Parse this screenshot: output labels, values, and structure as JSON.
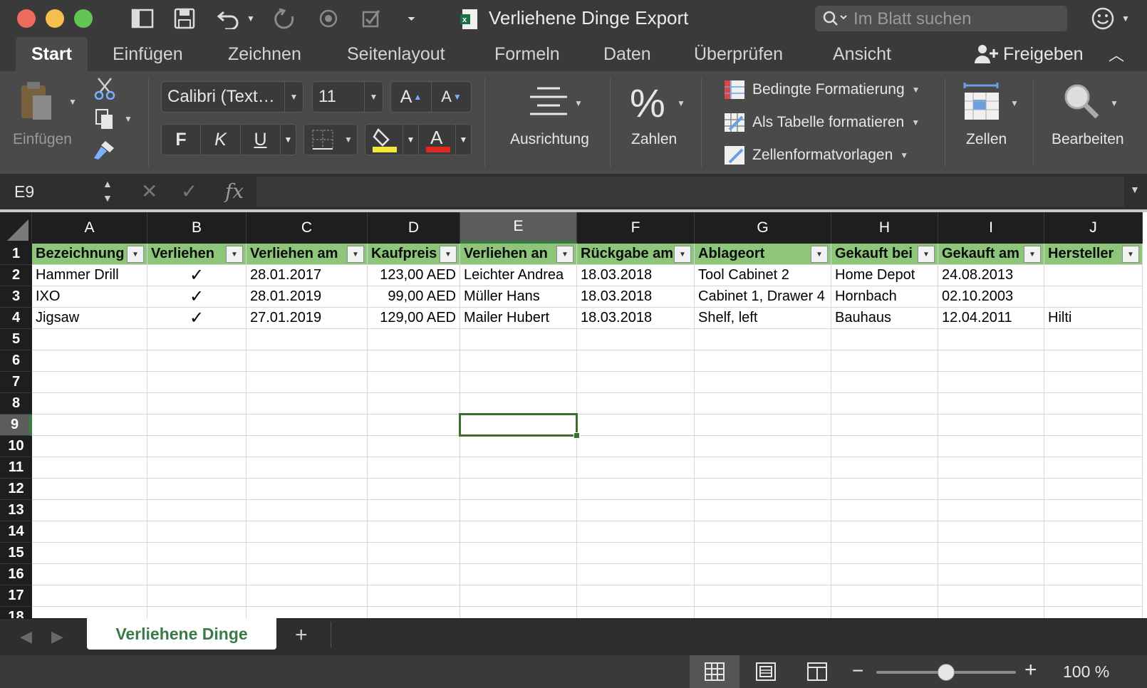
{
  "window": {
    "title": "Verliehene Dinge Export",
    "search_placeholder": "Im Blatt suchen"
  },
  "ribbon_tabs": [
    "Start",
    "Einfügen",
    "Zeichnen",
    "Seitenlayout",
    "Formeln",
    "Daten",
    "Überprüfen",
    "Ansicht"
  ],
  "share_label": "Freigeben",
  "ribbon": {
    "paste_label": "Einfügen",
    "font_name": "Calibri (Text…",
    "font_size": "11",
    "grow_font": "A",
    "shrink_font": "A",
    "bold": "F",
    "italic": "K",
    "underline": "U",
    "alignment_label": "Ausrichtung",
    "numbers_symbol": "%",
    "numbers_label": "Zahlen",
    "conditional_formatting": "Bedingte Formatierung",
    "format_as_table": "Als Tabelle formatieren",
    "cell_styles": "Zellenformatvorlagen",
    "cells_label": "Zellen",
    "edit_label": "Bearbeiten"
  },
  "formula_bar": {
    "name_box": "E9",
    "fx": "fx",
    "content": ""
  },
  "grid": {
    "columns": [
      "A",
      "B",
      "C",
      "D",
      "E",
      "F",
      "G",
      "H",
      "I",
      "J"
    ],
    "rows": [
      "1",
      "2",
      "3",
      "4",
      "5",
      "6",
      "7",
      "8",
      "9",
      "10",
      "11",
      "12",
      "13",
      "14",
      "15",
      "16",
      "17"
    ],
    "partial_row": "18",
    "headers": [
      "Bezeichnung",
      "Verliehen",
      "Verliehen am",
      "Kaufpreis",
      "Verliehen an",
      "Rückgabe am",
      "Ablageort",
      "Gekauft bei",
      "Gekauft am",
      "Hersteller"
    ],
    "data": [
      [
        "Hammer Drill",
        "✓",
        "28.01.2017",
        "123,00 AED",
        "Leichter Andrea",
        "18.03.2018",
        "Tool Cabinet 2",
        "Home Depot",
        "24.08.2013",
        ""
      ],
      [
        "IXO",
        "✓",
        "28.01.2019",
        "99,00 AED",
        "Müller Hans",
        "18.03.2018",
        "Cabinet 1, Drawer 4",
        "Hornbach",
        "02.10.2003",
        ""
      ],
      [
        "Jigsaw",
        "✓",
        "27.01.2019",
        "129,00 AED",
        "Mailer Hubert",
        "18.03.2018",
        "Shelf, left",
        "Bauhaus",
        "12.04.2011",
        "Hilti"
      ]
    ],
    "selected_cell": "E9",
    "colors": {
      "header_fill": "#8dc57a",
      "selection": "#3c6e2e"
    }
  },
  "sheet_tabs": [
    "Verliehene Dinge"
  ],
  "add_sheet": "+",
  "status": {
    "zoom_label": "100 %",
    "zoom_fraction": 0.5
  }
}
